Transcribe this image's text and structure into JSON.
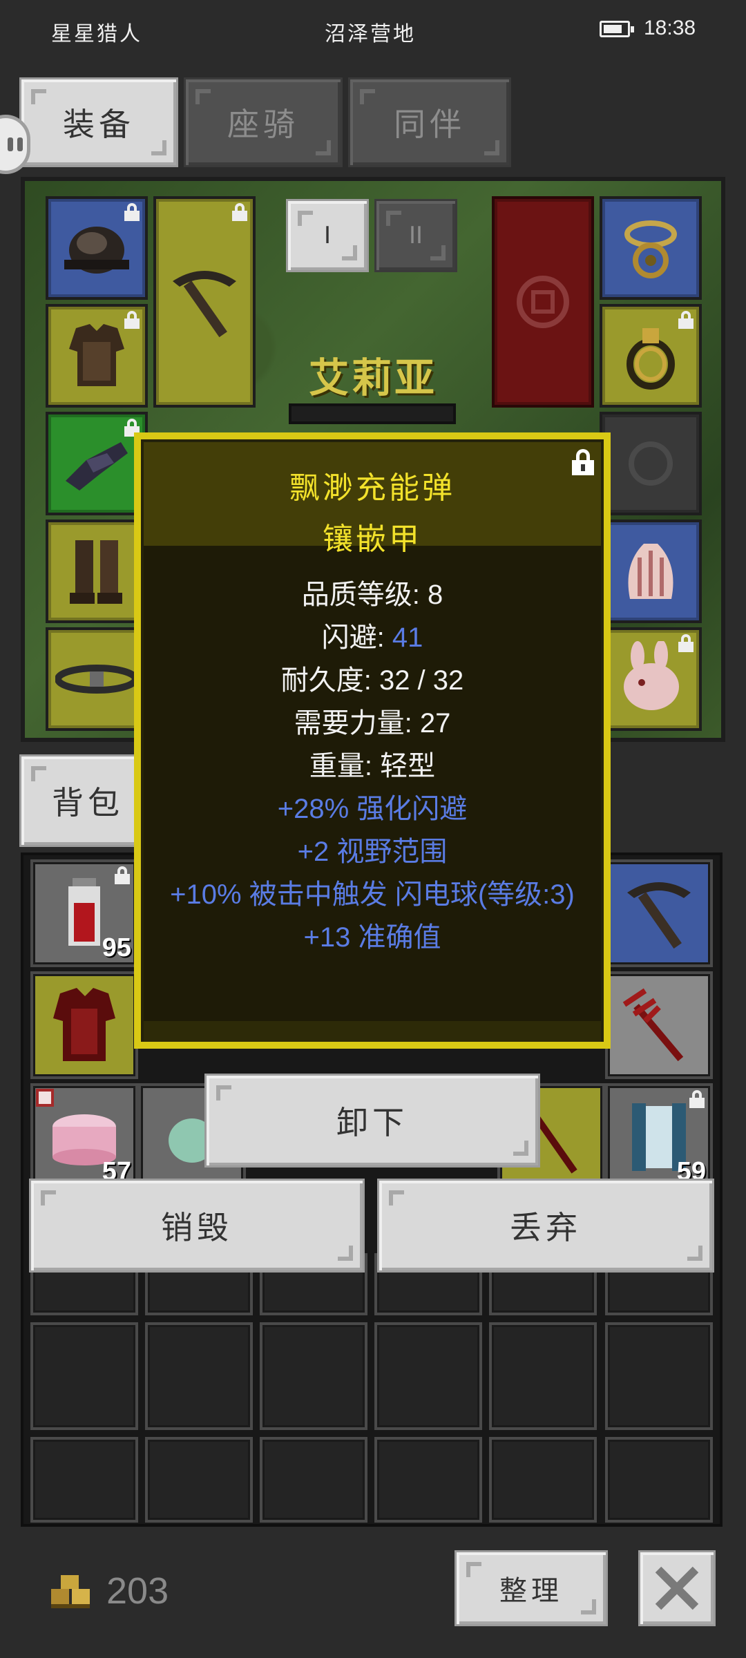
{
  "status_bar": {
    "app_name": "星星猎人",
    "location": "沼泽营地",
    "time": "18:38",
    "battery_icon": "battery-icon"
  },
  "tabs": [
    {
      "label": "装备",
      "active": true
    },
    {
      "label": "座骑",
      "active": false
    },
    {
      "label": "同伴",
      "active": false
    }
  ],
  "loadout_toggle": [
    "I",
    "II"
  ],
  "character": {
    "name": "艾莉亚"
  },
  "tooltip": {
    "name": "飘渺充能弹",
    "type": "镶嵌甲",
    "lines": [
      {
        "label": "品质等级",
        "sep": ": ",
        "value": "8"
      },
      {
        "label": "闪避",
        "sep": ": ",
        "value": "41"
      },
      {
        "label": "耐久度",
        "sep": ": ",
        "value": "32 / 32"
      },
      {
        "label": "需要力量",
        "sep": ": ",
        "value": "27"
      },
      {
        "label": "重量",
        "sep": ": ",
        "value": "轻型"
      }
    ],
    "affixes": [
      "+28% 强化闪避",
      "+2 视野范围",
      "+10% 被击中触发 闪电球(等级:3)",
      "+13 准确值"
    ],
    "lock_icon": "lock-icon"
  },
  "bag": {
    "tab_label": "背包",
    "counts": {
      "potion": "95",
      "cake": "57",
      "scroll": "59"
    }
  },
  "actions": {
    "unequip": "卸下",
    "destroy": "销毁",
    "discard": "丢弃",
    "sort": "整理"
  },
  "footer": {
    "gold": "203",
    "gold_icon": "gold-coins-icon",
    "close_icon": "close-icon"
  },
  "colors": {
    "tooltip_border": "#d9c915",
    "tooltip_title": "#f3e22b",
    "affix_blue": "#5a7ce4",
    "slot_blue": "#3f5aa0",
    "slot_yellow": "#9a9a2c",
    "slot_green": "#2b8f2b"
  }
}
